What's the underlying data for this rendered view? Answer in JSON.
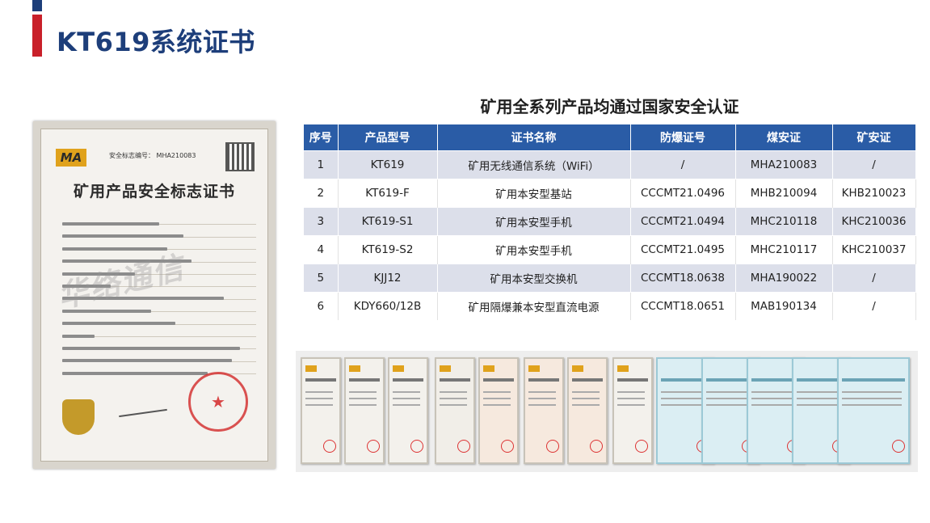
{
  "page": {
    "title": "KT619系统证书"
  },
  "certificate": {
    "badge": "MA",
    "number": "安全标志编号：  MHA210083",
    "title": "矿用产品安全标志证书",
    "watermark": "华络通信"
  },
  "section": {
    "heading": "矿用全系列产品均通过国家安全认证"
  },
  "table": {
    "headers": [
      "序号",
      "产品型号",
      "证书名称",
      "防爆证号",
      "煤安证",
      "矿安证"
    ],
    "rows": [
      [
        "1",
        "KT619",
        "矿用无线通信系统（WiFi）",
        "/",
        "MHA210083",
        "/"
      ],
      [
        "2",
        "KT619-F",
        "矿用本安型基站",
        "CCCMT21.0496",
        "MHB210094",
        "KHB210023"
      ],
      [
        "3",
        "KT619-S1",
        "矿用本安型手机",
        "CCCMT21.0494",
        "MHC210118",
        "KHC210036"
      ],
      [
        "4",
        "KT619-S2",
        "矿用本安型手机",
        "CCCMT21.0495",
        "MHC210117",
        "KHC210037"
      ],
      [
        "5",
        "KJJ12",
        "矿用本安型交换机",
        "CCCMT18.0638",
        "MHA190022",
        "/"
      ],
      [
        "6",
        "KDY660/12B",
        "矿用隔爆兼本安型直流电源",
        "CCCMT18.0651",
        "MAB190134",
        "/"
      ]
    ]
  },
  "colors": {
    "title": "#1d3e7a",
    "accent": "#c9202a",
    "table_header": "#2a5ca6",
    "row_alt": "#dcdfea"
  }
}
